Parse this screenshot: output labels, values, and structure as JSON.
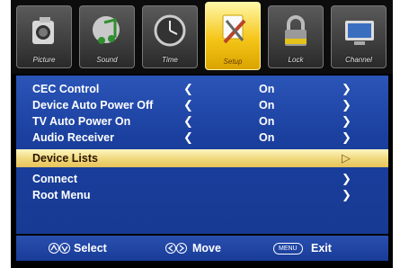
{
  "tabs": [
    {
      "label": "Picture",
      "icon": "camera-icon",
      "active": false
    },
    {
      "label": "Sound",
      "icon": "music-note-icon",
      "active": false
    },
    {
      "label": "Time",
      "icon": "clock-icon",
      "active": false
    },
    {
      "label": "Setup",
      "icon": "tools-icon",
      "active": true
    },
    {
      "label": "Lock",
      "icon": "padlock-icon",
      "active": false
    },
    {
      "label": "Channel",
      "icon": "monitor-icon",
      "active": false
    }
  ],
  "menu": [
    {
      "name": "CEC Control",
      "value": "On",
      "left_arrow": "❮",
      "right_arrow": "❯"
    },
    {
      "name": "Device Auto Power Off",
      "value": "On",
      "left_arrow": "❮",
      "right_arrow": "❯"
    },
    {
      "name": "TV Auto Power On",
      "value": "On",
      "left_arrow": "❮",
      "right_arrow": "❯"
    },
    {
      "name": "Audio Receiver",
      "value": "On",
      "left_arrow": "❮",
      "right_arrow": "❯"
    },
    {
      "name": "Device Lists",
      "value": "",
      "left_arrow": "",
      "right_arrow": "▷",
      "selected": true
    },
    {
      "name": "Connect",
      "value": "",
      "left_arrow": "",
      "right_arrow": "❯"
    },
    {
      "name": "Root Menu",
      "value": "",
      "left_arrow": "",
      "right_arrow": "❯"
    }
  ],
  "footer": {
    "select_label": "Select",
    "select_icon": "up-down-buttons-icon",
    "move_label": "Move",
    "move_icon": "left-right-buttons-icon",
    "menu_key": "MENU",
    "exit_label": "Exit"
  },
  "colors": {
    "panel_blue": "#1a3f9e",
    "selected_highlight": "#f0d77a",
    "active_tab": "#f5c518"
  }
}
